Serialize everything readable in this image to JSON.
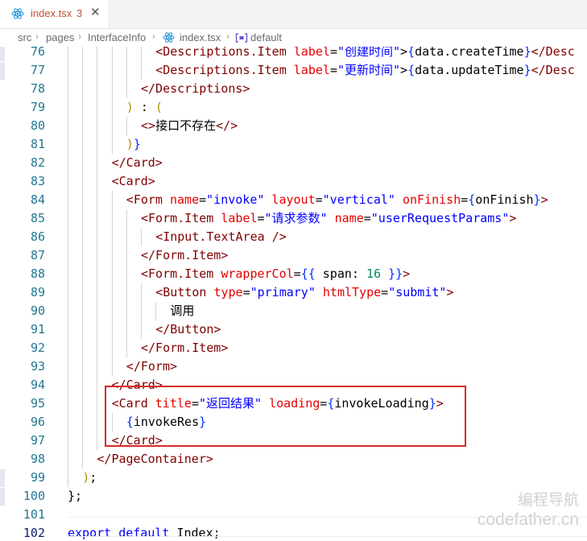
{
  "tab": {
    "title": "index.tsx",
    "count": "3",
    "icon": "react-icon",
    "close": "✕"
  },
  "breadcrumb": {
    "items": [
      "src",
      "pages",
      "InterfaceInfo",
      "index.tsx",
      "default"
    ],
    "separator": "›"
  },
  "colors": {
    "accent_box": "#d72b2b",
    "tag": "#800000",
    "attr": "#e50000",
    "string": "#0000ff"
  },
  "lines": [
    {
      "n": "76",
      "indent": 6,
      "tokens": [
        [
          "tag",
          "<Descriptions.Item"
        ],
        [
          "t",
          " "
        ],
        [
          "attr",
          "label"
        ],
        [
          "t",
          "="
        ],
        [
          "str",
          "\"创建时间\""
        ],
        [
          "t",
          ">"
        ],
        [
          "brace",
          "{"
        ],
        [
          "t",
          "data.createTime"
        ],
        [
          "brace",
          "}"
        ],
        [
          "tag",
          "</Desc"
        ]
      ]
    },
    {
      "n": "77",
      "indent": 6,
      "tokens": [
        [
          "tag",
          "<Descriptions.Item"
        ],
        [
          "t",
          " "
        ],
        [
          "attr",
          "label"
        ],
        [
          "t",
          "="
        ],
        [
          "str",
          "\"更新时间\""
        ],
        [
          "t",
          ">"
        ],
        [
          "brace",
          "{"
        ],
        [
          "t",
          "data.updateTime"
        ],
        [
          "brace",
          "}"
        ],
        [
          "tag",
          "</Desc"
        ]
      ]
    },
    {
      "n": "78",
      "indent": 5,
      "tokens": [
        [
          "tag",
          "</Descriptions>"
        ]
      ]
    },
    {
      "n": "79",
      "indent": 4,
      "tokens": [
        [
          "paren",
          ")"
        ],
        [
          "t",
          " : "
        ],
        [
          "paren",
          "("
        ]
      ]
    },
    {
      "n": "80",
      "indent": 5,
      "tokens": [
        [
          "tag",
          "<>"
        ],
        [
          "t",
          "接口不存在"
        ],
        [
          "tag",
          "</>"
        ]
      ]
    },
    {
      "n": "81",
      "indent": 4,
      "tokens": [
        [
          "paren",
          ")"
        ],
        [
          "brace",
          "}"
        ]
      ]
    },
    {
      "n": "82",
      "indent": 3,
      "tokens": [
        [
          "tag",
          "</Card>"
        ]
      ]
    },
    {
      "n": "83",
      "indent": 3,
      "tokens": [
        [
          "tag",
          "<Card>"
        ]
      ]
    },
    {
      "n": "84",
      "indent": 4,
      "tokens": [
        [
          "tag",
          "<Form"
        ],
        [
          "t",
          " "
        ],
        [
          "attr",
          "name"
        ],
        [
          "t",
          "="
        ],
        [
          "str",
          "\"invoke\""
        ],
        [
          "t",
          " "
        ],
        [
          "attr",
          "layout"
        ],
        [
          "t",
          "="
        ],
        [
          "str",
          "\"vertical\""
        ],
        [
          "t",
          " "
        ],
        [
          "attr",
          "onFinish"
        ],
        [
          "t",
          "="
        ],
        [
          "brace",
          "{"
        ],
        [
          "t",
          "onFinish"
        ],
        [
          "brace",
          "}"
        ],
        [
          "tag",
          ">"
        ]
      ]
    },
    {
      "n": "85",
      "indent": 5,
      "tokens": [
        [
          "tag",
          "<Form.Item"
        ],
        [
          "t",
          " "
        ],
        [
          "attr",
          "label"
        ],
        [
          "t",
          "="
        ],
        [
          "str",
          "\"请求参数\""
        ],
        [
          "t",
          " "
        ],
        [
          "attr",
          "name"
        ],
        [
          "t",
          "="
        ],
        [
          "str",
          "\"userRequestParams\""
        ],
        [
          "tag",
          ">"
        ]
      ]
    },
    {
      "n": "86",
      "indent": 6,
      "tokens": [
        [
          "tag",
          "<Input.TextArea"
        ],
        [
          "t",
          " "
        ],
        [
          "tag",
          "/>"
        ]
      ]
    },
    {
      "n": "87",
      "indent": 5,
      "tokens": [
        [
          "tag",
          "</Form.Item>"
        ]
      ]
    },
    {
      "n": "88",
      "indent": 5,
      "tokens": [
        [
          "tag",
          "<Form.Item"
        ],
        [
          "t",
          " "
        ],
        [
          "attr",
          "wrapperCol"
        ],
        [
          "t",
          "="
        ],
        [
          "brace",
          "{{"
        ],
        [
          "t",
          " span: "
        ],
        [
          "num",
          "16"
        ],
        [
          "t",
          " "
        ],
        [
          "brace",
          "}}"
        ],
        [
          "tag",
          ">"
        ]
      ]
    },
    {
      "n": "89",
      "indent": 6,
      "tokens": [
        [
          "tag",
          "<Button"
        ],
        [
          "t",
          " "
        ],
        [
          "attr",
          "type"
        ],
        [
          "t",
          "="
        ],
        [
          "str",
          "\"primary\""
        ],
        [
          "t",
          " "
        ],
        [
          "attr",
          "htmlType"
        ],
        [
          "t",
          "="
        ],
        [
          "str",
          "\"submit\""
        ],
        [
          "tag",
          ">"
        ]
      ]
    },
    {
      "n": "90",
      "indent": 7,
      "tokens": [
        [
          "t",
          "调用"
        ]
      ]
    },
    {
      "n": "91",
      "indent": 6,
      "tokens": [
        [
          "tag",
          "</Button>"
        ]
      ]
    },
    {
      "n": "92",
      "indent": 5,
      "tokens": [
        [
          "tag",
          "</Form.Item>"
        ]
      ]
    },
    {
      "n": "93",
      "indent": 4,
      "tokens": [
        [
          "tag",
          "</Form>"
        ]
      ]
    },
    {
      "n": "94",
      "indent": 3,
      "tokens": [
        [
          "tag",
          "</Card>"
        ]
      ]
    },
    {
      "n": "95",
      "indent": 3,
      "tokens": [
        [
          "tag",
          "<Card"
        ],
        [
          "t",
          " "
        ],
        [
          "attr",
          "title"
        ],
        [
          "t",
          "="
        ],
        [
          "str",
          "\"返回结果\""
        ],
        [
          "t",
          " "
        ],
        [
          "attr",
          "loading"
        ],
        [
          "t",
          "="
        ],
        [
          "brace",
          "{"
        ],
        [
          "t",
          "invokeLoading"
        ],
        [
          "brace",
          "}"
        ],
        [
          "tag",
          ">"
        ]
      ]
    },
    {
      "n": "96",
      "indent": 4,
      "tokens": [
        [
          "brace",
          "{"
        ],
        [
          "t",
          "invokeRes"
        ],
        [
          "brace",
          "}"
        ]
      ]
    },
    {
      "n": "97",
      "indent": 3,
      "tokens": [
        [
          "tag",
          "</Card>"
        ]
      ]
    },
    {
      "n": "98",
      "indent": 2,
      "tokens": [
        [
          "tag",
          "</PageContainer>"
        ]
      ]
    },
    {
      "n": "99",
      "indent": 1,
      "tokens": [
        [
          "paren",
          ")"
        ],
        [
          "t",
          ";"
        ]
      ]
    },
    {
      "n": "100",
      "indent": 0,
      "tokens": [
        [
          "t",
          "};"
        ]
      ]
    },
    {
      "n": "101",
      "indent": 0,
      "tokens": []
    },
    {
      "n": "102",
      "indent": 0,
      "tokens": [
        [
          "kw",
          "export"
        ],
        [
          "t",
          " "
        ],
        [
          "kw",
          "default"
        ],
        [
          "t",
          " Index;"
        ]
      ]
    }
  ],
  "watermark": {
    "line1": "编程导航",
    "line2": "codefather.cn"
  }
}
